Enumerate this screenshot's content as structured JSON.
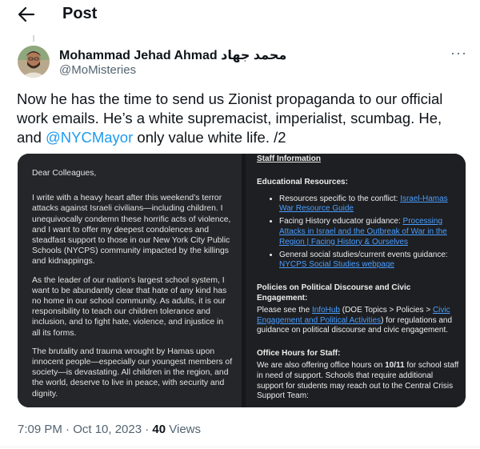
{
  "header": {
    "title": "Post"
  },
  "author": {
    "name": "Mohammad Jehad Ahmad",
    "name_arabic": "محمد جهاد",
    "handle": "@MoMisteries"
  },
  "tweet": {
    "text_before": "Now he has the time to send us Zionist propaganda to our official work emails. He’s a white supremacist, imperialist, scumbag. He, and ",
    "mention": "@NYCMayor",
    "text_after": " only value white life. /2"
  },
  "letter": {
    "greeting": "Dear Colleagues,",
    "p1": "I write with a heavy heart after this weekend’s terror attacks against Israeli civilians—including children. I unequivocally condemn these horrific acts of violence, and I want to offer my deepest condolences and steadfast support to those in our New York City Public Schools (NYCPS) community impacted by the killings and kidnappings.",
    "p2": "As the leader of our nation’s largest school system, I want to be abundantly clear that hate of any kind has no home in our school community. As adults, it is our responsibility to teach our children tolerance and inclusion, and to fight hate, violence, and injustice in all its forms.",
    "p3": "The brutality and trauma wrought by Hamas upon innocent people—especially our youngest members of society—is devastating. All children in the region, and the world, deserve to live in peace, with security and dignity."
  },
  "staff_info": {
    "title": "Staff Information",
    "resources_heading": "Educational Resources:",
    "r1_text": "Resources specific to the conflict: ",
    "r1_link": "Israel-Hamas War Resource Guide",
    "r2_text": "Facing History educator guidance: ",
    "r2_link": "Processing Attacks in Israel and the Outbreak of War in the Region | Facing History & Ourselves",
    "r3_text": "General social studies/current events guidance: ",
    "r3_link": "NYCPS Social Studies webpage",
    "policies_heading": "Policies on Political Discourse and Civic Engagement:",
    "policies_text_1": "Please see the ",
    "policies_link_1": "InfoHub",
    "policies_text_2": " (DOE Topics > Policies > ",
    "policies_link_2": "Civic Engagement and Political Activities",
    "policies_text_3": ") for regulations and guidance on political discourse and civic engagement.",
    "office_heading": "Office Hours for Staff:",
    "office_text_1": "We are also offering office hours on ",
    "office_date": "10/11",
    "office_text_2": " for school staff in need of support. Schools that require additional support for students may reach out to the Central Crisis Support Team:"
  },
  "footer": {
    "timestamp": "7:09 PM · Oct 10, 2023 · ",
    "views_count": "40",
    "views_label": " Views"
  }
}
